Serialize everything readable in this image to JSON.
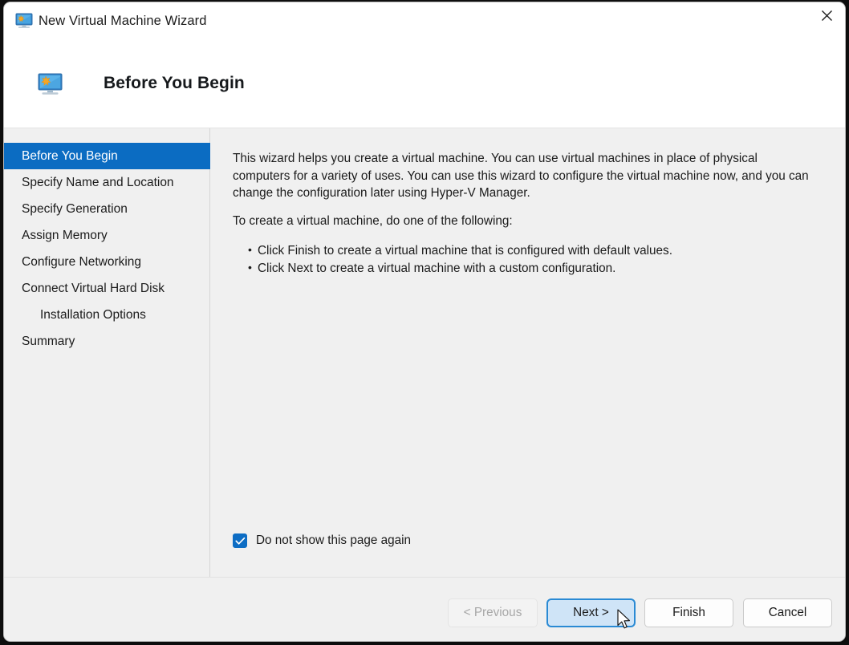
{
  "window": {
    "title": "New Virtual Machine Wizard",
    "title_icon": "virtual-machine-monitor-icon",
    "close_label": "✕"
  },
  "header": {
    "title": "Before You Begin",
    "icon": "virtual-machine-monitor-icon"
  },
  "sidebar": {
    "items": [
      {
        "label": "Before You Begin",
        "selected": true,
        "indent": false
      },
      {
        "label": "Specify Name and Location",
        "selected": false,
        "indent": false
      },
      {
        "label": "Specify Generation",
        "selected": false,
        "indent": false
      },
      {
        "label": "Assign Memory",
        "selected": false,
        "indent": false
      },
      {
        "label": "Configure Networking",
        "selected": false,
        "indent": false
      },
      {
        "label": "Connect Virtual Hard Disk",
        "selected": false,
        "indent": false
      },
      {
        "label": "Installation Options",
        "selected": false,
        "indent": true
      },
      {
        "label": "Summary",
        "selected": false,
        "indent": false
      }
    ]
  },
  "content": {
    "paragraph1": "This wizard helps you create a virtual machine. You can use virtual machines in place of physical computers for a variety of uses. You can use this wizard to configure the virtual machine now, and you can change the configuration later using Hyper-V Manager.",
    "paragraph2": "To create a virtual machine, do one of the following:",
    "bullets": [
      "Click Finish to create a virtual machine that is configured with default values.",
      "Click Next to create a virtual machine with a custom configuration."
    ],
    "checkbox": {
      "label": "Do not show this page again",
      "checked": true
    }
  },
  "footer": {
    "buttons": [
      {
        "label": "< Previous",
        "state": "disabled"
      },
      {
        "label": "Next >",
        "state": "default-focused"
      },
      {
        "label": "Finish",
        "state": "normal"
      },
      {
        "label": "Cancel",
        "state": "normal"
      }
    ]
  },
  "colors": {
    "accent": "#0b6cc2",
    "focus_border": "#2a8ad4",
    "focus_fill": "#cfe4f7",
    "body_bg": "#f0f0f0",
    "text": "#1b1b1b",
    "disabled_text": "#a8a8a8"
  }
}
